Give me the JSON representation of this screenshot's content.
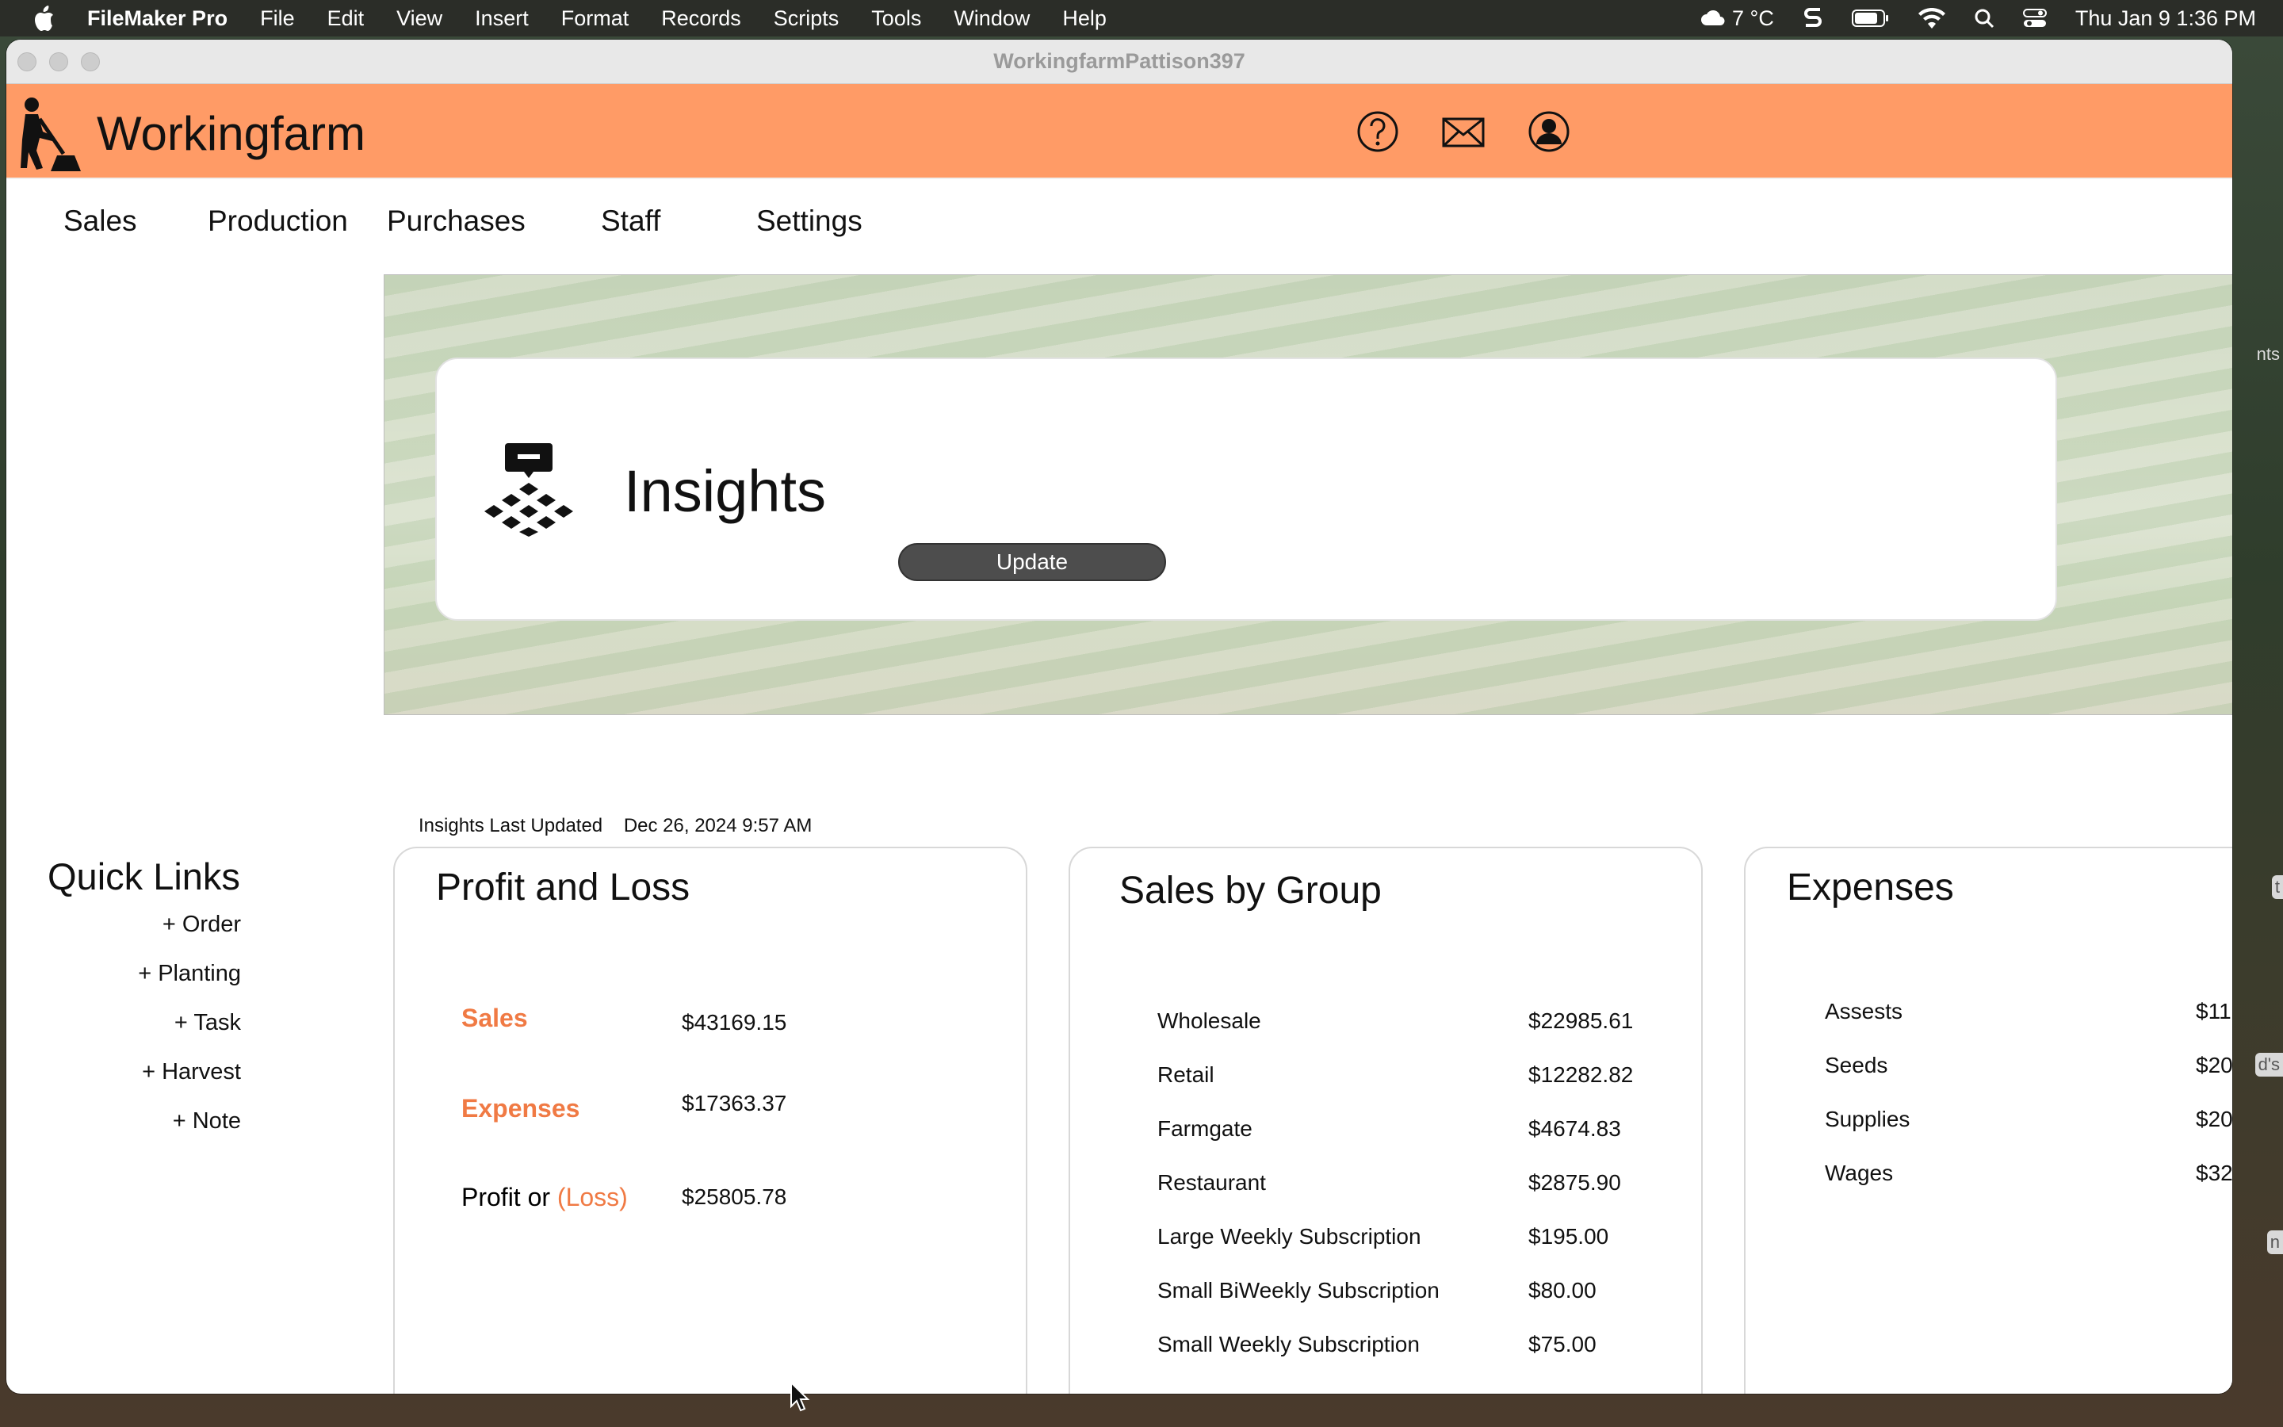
{
  "menubar": {
    "app": "FileMaker Pro",
    "items": [
      "File",
      "Edit",
      "View",
      "Insert",
      "Format",
      "Records",
      "Scripts",
      "Tools",
      "Window",
      "Help"
    ],
    "weather": "7 °C",
    "datetime": "Thu Jan 9  1:36 PM"
  },
  "window": {
    "title": "WorkingfarmPattison397"
  },
  "header": {
    "app_name": "Workingfarm",
    "accent_color": "#ff9b66"
  },
  "nav": {
    "items": [
      "Sales",
      "Production",
      "Purchases",
      "Staff",
      "Settings"
    ]
  },
  "insights": {
    "title": "Insights",
    "update_label": "Update",
    "last_updated_label": "Insights Last Updated",
    "last_updated_value": "Dec 26, 2024 9:57 AM"
  },
  "quick_links": {
    "title": "Quick Links",
    "items": [
      "+ Order",
      "+ Planting",
      "+ Task",
      "+ Harvest",
      "+ Note"
    ]
  },
  "profit_loss": {
    "title": "Profit and Loss",
    "sales_label": "Sales",
    "sales_value": "$43169.15",
    "expenses_label": "Expenses",
    "expenses_value": "$17363.37",
    "profit_label": "Profit or",
    "loss_label": "(Loss)",
    "profit_value": "$25805.78"
  },
  "sales_by_group": {
    "title": "Sales by Group",
    "rows": [
      {
        "label": "Wholesale",
        "value": "$22985.61"
      },
      {
        "label": "Retail",
        "value": "$12282.82"
      },
      {
        "label": "Farmgate",
        "value": "$4674.83"
      },
      {
        "label": "Restaurant",
        "value": "$2875.90"
      },
      {
        "label": "Large Weekly Subscription",
        "value": "$195.00"
      },
      {
        "label": "Small BiWeekly Subscription",
        "value": "$80.00"
      },
      {
        "label": "Small Weekly Subscription",
        "value": "$75.00"
      }
    ]
  },
  "expenses": {
    "title": "Expenses",
    "rows": [
      {
        "label": "Assests",
        "value": "$11"
      },
      {
        "label": "Seeds",
        "value": "$20"
      },
      {
        "label": "Supplies",
        "value": "$20"
      },
      {
        "label": "Wages",
        "value": "$32"
      }
    ]
  },
  "edge_tabs": [
    "nts",
    "t",
    "d's",
    "n"
  ]
}
